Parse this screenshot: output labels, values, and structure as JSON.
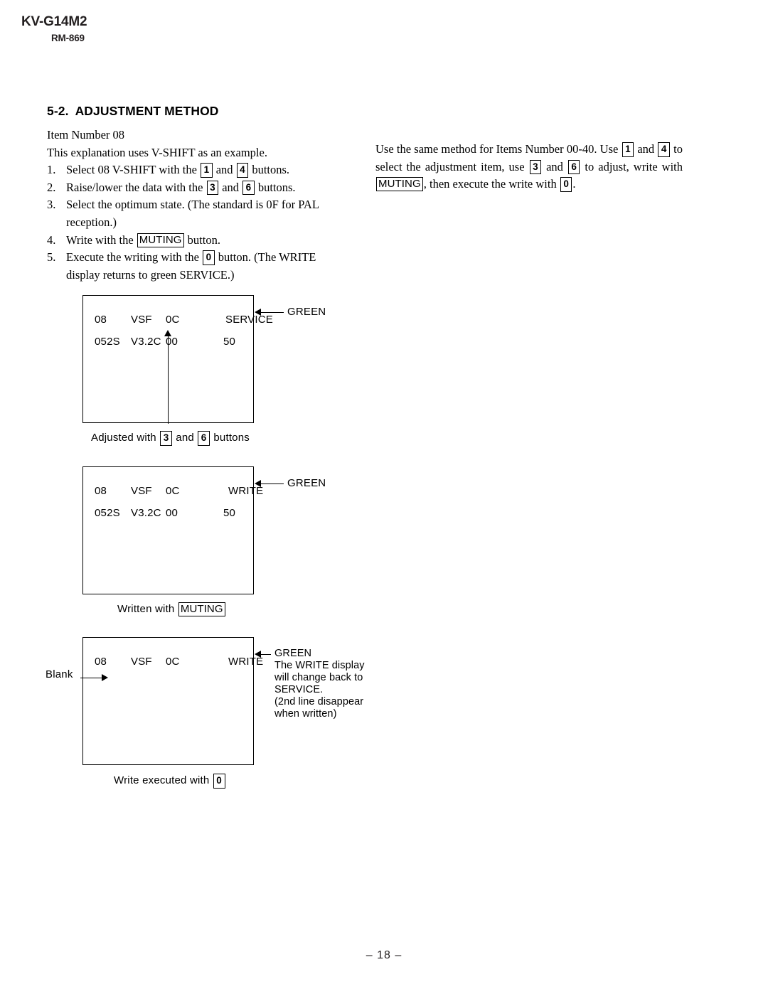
{
  "header": {
    "model": "KV-G14M2",
    "remote": "RM-869"
  },
  "section": {
    "number": "5-2.",
    "title": "ADJUSTMENT METHOD"
  },
  "intro": {
    "item_number": "Item Number 08",
    "explanation": "This explanation uses V-SHIFT as an example."
  },
  "steps": [
    {
      "n": "1.",
      "parts": [
        "Select 08 V-SHIFT with the ",
        " and ",
        " buttons."
      ],
      "keys": [
        "1",
        "4"
      ]
    },
    {
      "n": "2.",
      "parts": [
        "Raise/lower the data with the ",
        " and ",
        " buttons."
      ],
      "keys": [
        "3",
        "6"
      ]
    },
    {
      "n": "3.",
      "line1": "Select the optimum state. (The standard is 0F for PAL",
      "line2": "reception.)"
    },
    {
      "n": "4.",
      "parts": [
        "Write with the ",
        " button."
      ],
      "keys": [
        "MUTING"
      ]
    },
    {
      "n": "5.",
      "line1a": "Execute the writing with the ",
      "line1b": " button. (The WRITE",
      "key": "0",
      "line2": "display returns to green SERVICE.)"
    }
  ],
  "right_column": {
    "t1": "Use the same method for Items Number 00-40. Use ",
    "k1": "1",
    "t2": " and ",
    "k2": "4",
    "t3": " to select the adjustment item, use ",
    "k3": "3",
    "t4": " and ",
    "k4": "6",
    "t5": " to adjust, write with ",
    "k5": "MUTING",
    "t6": ", then execute the write with ",
    "k6": "0",
    "t7": "."
  },
  "diagrams": [
    {
      "name": "service-display",
      "row1": [
        "08",
        "VSF",
        "0C",
        "SERVICE"
      ],
      "row2": [
        "052S",
        "V3.2C",
        "00",
        "50"
      ],
      "arrow_label": "GREEN",
      "caption_parts": [
        "Adjusted with ",
        " and ",
        " buttons"
      ],
      "caption_keys": [
        "3",
        "6"
      ]
    },
    {
      "name": "write-display",
      "row1": [
        "08",
        "VSF",
        "0C",
        "WRITE"
      ],
      "row2": [
        "052S",
        "V3.2C",
        "00",
        "50"
      ],
      "arrow_label": "GREEN",
      "caption_parts": [
        "Written with ",
        ""
      ],
      "caption_keys": [
        "MUTING"
      ]
    },
    {
      "name": "write-executed-display",
      "row1": [
        "08",
        "VSF",
        "0C",
        "WRITE"
      ],
      "row2": [
        "",
        "",
        "",
        ""
      ],
      "blank_label": "Blank",
      "arrow_label": "GREEN",
      "note_lines": [
        "The WRITE display",
        "will change back to",
        "SERVICE.",
        "(2nd line disappear",
        "when written)"
      ],
      "caption_parts": [
        "Write executed with ",
        ""
      ],
      "caption_keys": [
        "0"
      ]
    }
  ],
  "footer": {
    "page": "– 18 –"
  }
}
